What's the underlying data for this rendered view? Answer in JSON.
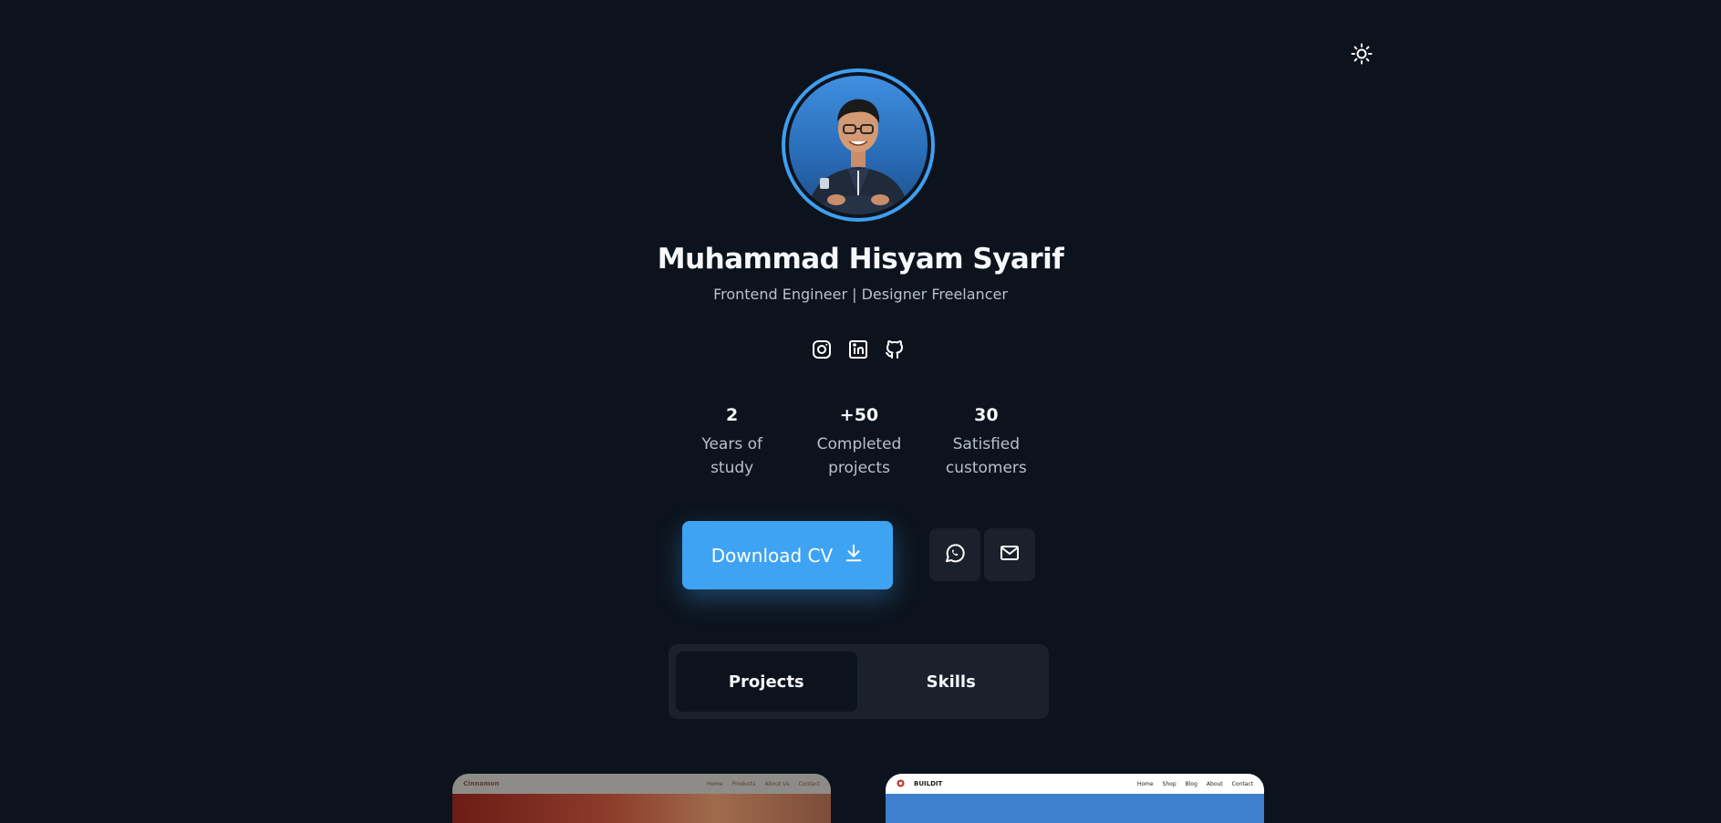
{
  "profile": {
    "name": "Muhammad Hisyam Syarif",
    "subtitle": "Frontend Engineer | Designer Freelancer",
    "avatar_alt": "profile photo"
  },
  "socials": [
    {
      "icon": "instagram-icon"
    },
    {
      "icon": "linkedin-icon"
    },
    {
      "icon": "github-icon"
    }
  ],
  "stats": [
    {
      "value": "2",
      "label_line1": "Years of",
      "label_line2": "study"
    },
    {
      "value": "+50",
      "label_line1": "Completed",
      "label_line2": "projects"
    },
    {
      "value": "30",
      "label_line1": "Satisfied",
      "label_line2": "customers"
    }
  ],
  "actions": {
    "download_label": "Download CV",
    "whatsapp_icon": "whatsapp-icon",
    "email_icon": "mail-icon"
  },
  "tabs": [
    {
      "label": "Projects",
      "active": true
    },
    {
      "label": "Skills",
      "active": false
    }
  ],
  "projects": [
    {
      "brand": "Cinnamon",
      "nav": [
        "Home",
        "Products",
        "About Us",
        "Contact"
      ]
    },
    {
      "brand": "BUILDIT",
      "nav": [
        "Home",
        "Shop",
        "Blog",
        "About",
        "Contact"
      ]
    }
  ],
  "colors": {
    "background": "#0d131d",
    "accent": "#3ea3f2",
    "surface": "#1a212c",
    "muted_text": "#b9c0cb"
  }
}
